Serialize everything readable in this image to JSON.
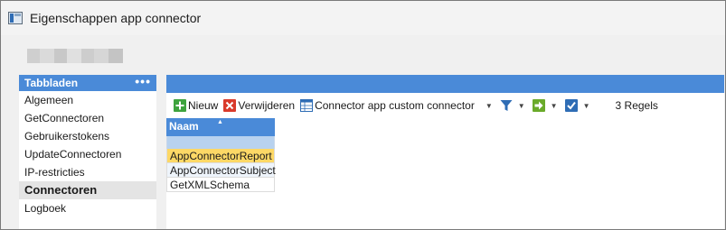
{
  "window": {
    "title": "Eigenschappen app connector",
    "icon": "app-window-icon"
  },
  "sidebar": {
    "header": "Tabbladen",
    "more_label": "•••",
    "items": [
      {
        "label": "Algemeen"
      },
      {
        "label": "GetConnectoren"
      },
      {
        "label": "Gebruikerstokens"
      },
      {
        "label": "UpdateConnectoren"
      },
      {
        "label": "IP-restricties"
      },
      {
        "label": "Connectoren",
        "active": true
      },
      {
        "label": "Logboek"
      }
    ]
  },
  "toolbar": {
    "new_label": "Nieuw",
    "delete_label": "Verwijderen",
    "connector_label": "Connector app custom connector",
    "rules_count": "3 Regels",
    "icons": [
      "plus-icon",
      "delete-x-icon",
      "grid-icon",
      "filter-icon",
      "export-arrow-icon",
      "checkbox-icon"
    ]
  },
  "grid": {
    "columns": [
      "Naam"
    ],
    "rows": [
      {
        "naam": "AppConnectorReport",
        "selected": true
      },
      {
        "naam": "AppConnectorSubject"
      },
      {
        "naam": "GetXMLSchema"
      }
    ]
  },
  "colors": {
    "accent_blue": "#4a8ad8",
    "selection_yellow": "#fdd866",
    "filter_row": "#b8d2ef"
  }
}
